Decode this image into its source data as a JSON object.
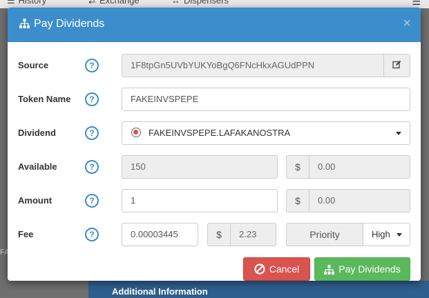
{
  "background": {
    "tabs": [
      {
        "label": "History",
        "icon": "list-icon"
      },
      {
        "label": "Exchange",
        "icon": "exchange-icon"
      },
      {
        "label": "Dispensers",
        "icon": "arrows-horizontal-icon"
      }
    ],
    "menu_icon": "hamburger-menu-icon",
    "bottom_panel_label": "Additional Information",
    "side_text": "FA"
  },
  "modal": {
    "title": "Pay Dividends",
    "title_icon": "sitemap-icon",
    "close_label": "×",
    "fields": {
      "source": {
        "label": "Source",
        "value": "1F8tpGn5UVbYUKYoBgQ6FNcHkxAGUdPPN",
        "edit_icon": "edit-icon"
      },
      "token_name": {
        "label": "Token Name",
        "value": "FAKEINVSPEPE"
      },
      "dividend": {
        "label": "Dividend",
        "value": "FAKEINVSPEPE.LAFAKANOSTRA"
      },
      "available": {
        "label": "Available",
        "value": "150",
        "usd_symbol": "$",
        "usd_value": "0.00"
      },
      "amount": {
        "label": "Amount",
        "value": "1",
        "usd_symbol": "$",
        "usd_value": "0.00"
      },
      "fee": {
        "label": "Fee",
        "value": "0.00003445",
        "usd_symbol": "$",
        "usd_value": "2.23",
        "priority_label": "Priority",
        "priority_value": "High"
      }
    },
    "help_glyph": "?",
    "buttons": {
      "cancel": "Cancel",
      "submit": "Pay Dividends"
    }
  },
  "colors": {
    "header": "#3c8dcb",
    "danger": "#d9534f",
    "success": "#5cb85c"
  }
}
